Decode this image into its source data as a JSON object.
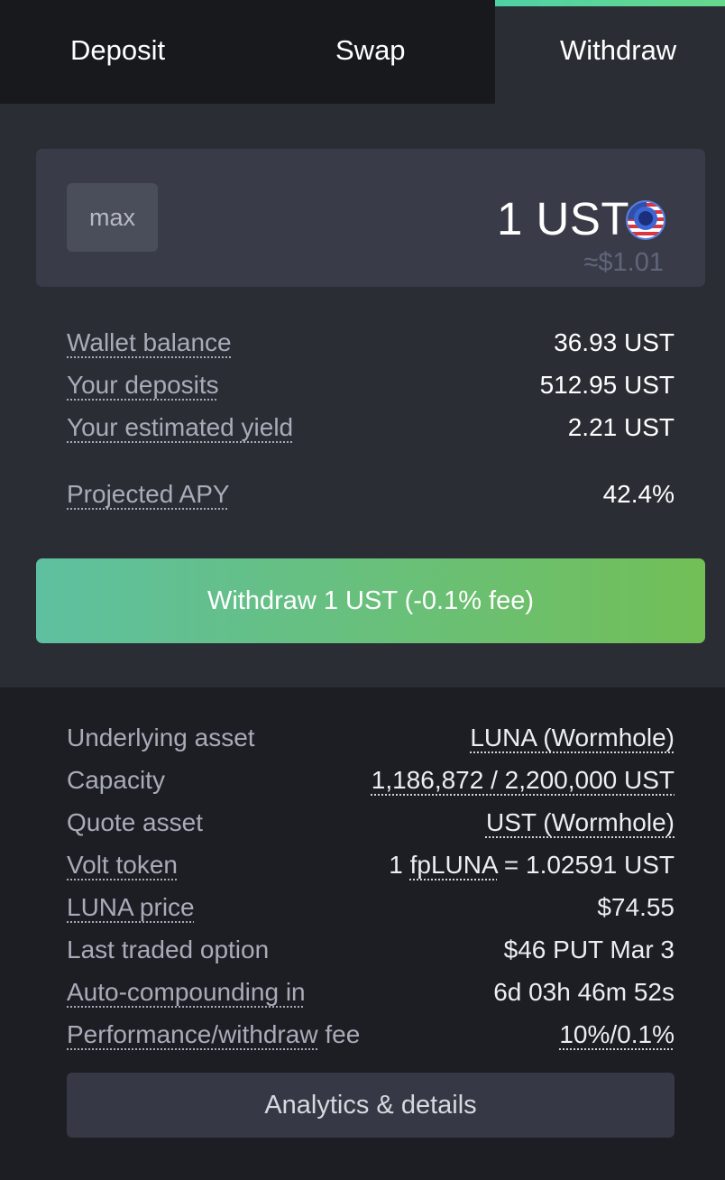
{
  "tabs": [
    {
      "label": "Deposit",
      "active": false
    },
    {
      "label": "Swap",
      "active": false
    },
    {
      "label": "Withdraw",
      "active": true
    }
  ],
  "amount": {
    "max_label": "max",
    "value": "1 UST",
    "token_icon": "ust-flag-icon",
    "usd_estimate": "≈$1.01"
  },
  "stats": [
    {
      "label": "Wallet balance",
      "value": "36.93 UST"
    },
    {
      "label": "Your deposits",
      "value": "512.95 UST"
    },
    {
      "label": "Your estimated yield",
      "value": "2.21 UST"
    },
    {
      "label": "Projected APY",
      "value": "42.4%"
    }
  ],
  "withdraw_button": {
    "label": "Withdraw 1 UST (-0.1% fee)"
  },
  "details": {
    "underlying_asset": {
      "label": "Underlying asset",
      "value": "LUNA (Wormhole)"
    },
    "capacity": {
      "label": "Capacity",
      "value": "1,186,872 / 2,200,000 UST"
    },
    "quote_asset": {
      "label": "Quote asset",
      "value": "UST (Wormhole)"
    },
    "volt_token": {
      "label": "Volt token",
      "value_prefix": "1 ",
      "value_token": "fpLUNA",
      "value_suffix": " = 1.02591 UST"
    },
    "luna_price": {
      "label": "LUNA price",
      "value": "$74.55"
    },
    "last_traded_option": {
      "label": "Last traded option",
      "value": "$46 PUT Mar 3"
    },
    "auto_compounding": {
      "label": "Auto-compounding in",
      "value": "6d 03h 46m 52s"
    },
    "fee": {
      "label_main": "Performance/withdraw",
      "label_suffix": " fee",
      "value": "10%/0.1%"
    }
  },
  "analytics_button": {
    "label": "Analytics & details"
  },
  "colors": {
    "accent_start": "#5ec0a0",
    "accent_end": "#72bf57",
    "background": "#1d1e24",
    "panel": "#2b2d35"
  }
}
